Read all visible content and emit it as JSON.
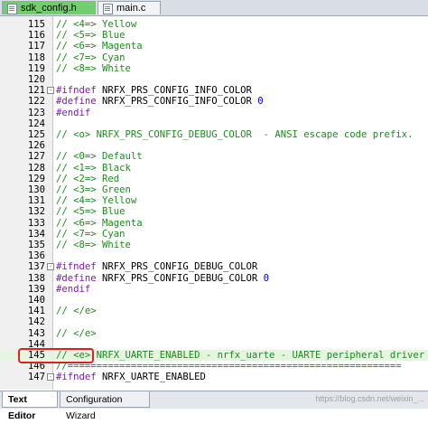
{
  "tabs": [
    {
      "label": "sdk_config.h",
      "active": true
    },
    {
      "label": "main.c",
      "active": false
    }
  ],
  "editor": {
    "lines": [
      {
        "num": "115",
        "text": "// <4=> Yellow",
        "kind": "comment"
      },
      {
        "num": "116",
        "text": "// <5=> Blue",
        "kind": "comment"
      },
      {
        "num": "117",
        "text": "// <6=> Magenta",
        "kind": "comment"
      },
      {
        "num": "118",
        "text": "// <7=> Cyan",
        "kind": "comment"
      },
      {
        "num": "119",
        "text": "// <8=> White",
        "kind": "comment"
      },
      {
        "num": "120",
        "text": "",
        "kind": "plain"
      },
      {
        "num": "121",
        "text": "#ifndef NRFX_PRS_CONFIG_INFO_COLOR",
        "kind": "pre",
        "fold": "-"
      },
      {
        "num": "122",
        "text": "#define NRFX_PRS_CONFIG_INFO_COLOR 0",
        "kind": "define"
      },
      {
        "num": "123",
        "text": "#endif",
        "kind": "pre"
      },
      {
        "num": "124",
        "text": "",
        "kind": "plain"
      },
      {
        "num": "125",
        "text": "// <o> NRFX_PRS_CONFIG_DEBUG_COLOR  - ANSI escape code prefix.",
        "kind": "comment"
      },
      {
        "num": "126",
        "text": "",
        "kind": "plain"
      },
      {
        "num": "127",
        "text": "// <0=> Default",
        "kind": "comment"
      },
      {
        "num": "128",
        "text": "// <1=> Black",
        "kind": "comment"
      },
      {
        "num": "129",
        "text": "// <2=> Red",
        "kind": "comment"
      },
      {
        "num": "130",
        "text": "// <3=> Green",
        "kind": "comment"
      },
      {
        "num": "131",
        "text": "// <4=> Yellow",
        "kind": "comment"
      },
      {
        "num": "132",
        "text": "// <5=> Blue",
        "kind": "comment"
      },
      {
        "num": "133",
        "text": "// <6=> Magenta",
        "kind": "comment"
      },
      {
        "num": "134",
        "text": "// <7=> Cyan",
        "kind": "comment"
      },
      {
        "num": "135",
        "text": "// <8=> White",
        "kind": "comment"
      },
      {
        "num": "136",
        "text": "",
        "kind": "plain"
      },
      {
        "num": "137",
        "text": "#ifndef NRFX_PRS_CONFIG_DEBUG_COLOR",
        "kind": "pre",
        "fold": "-"
      },
      {
        "num": "138",
        "text": "#define NRFX_PRS_CONFIG_DEBUG_COLOR 0",
        "kind": "define"
      },
      {
        "num": "139",
        "text": "#endif",
        "kind": "pre"
      },
      {
        "num": "140",
        "text": "",
        "kind": "plain"
      },
      {
        "num": "141",
        "text": "// </e>",
        "kind": "comment"
      },
      {
        "num": "142",
        "text": "",
        "kind": "plain"
      },
      {
        "num": "143",
        "text": "// </e>",
        "kind": "comment"
      },
      {
        "num": "144",
        "text": "",
        "kind": "plain"
      },
      {
        "num": "145",
        "text": "// <e> NRFX_UARTE_ENABLED - nrfx_uarte - UARTE peripheral driver",
        "kind": "comment",
        "current": true
      },
      {
        "num": "146",
        "text": "//==========================================================",
        "kind": "comment"
      },
      {
        "num": "147",
        "text": "#ifndef NRFX_UARTE_ENABLED",
        "kind": "pre",
        "fold": "-"
      }
    ]
  },
  "bottom_tabs": [
    {
      "label": "Text Editor",
      "active": true
    },
    {
      "label": "Configuration Wizard",
      "active": false
    }
  ],
  "watermark": "https://blog.csdn.net/weixin_...",
  "colors": {
    "comment": "#1f8a1f",
    "preprocessor": "#7a1ea3",
    "number": "#0000d0",
    "active_tab": "#6fcf6b",
    "highlight_box": "#e02020"
  }
}
